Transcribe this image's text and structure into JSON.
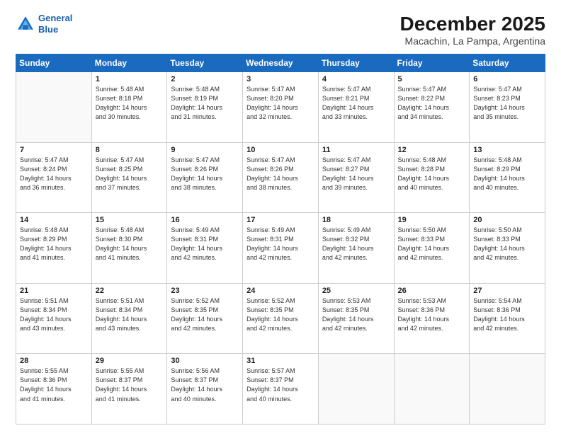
{
  "logo": {
    "line1": "General",
    "line2": "Blue"
  },
  "title": "December 2025",
  "subtitle": "Macachin, La Pampa, Argentina",
  "days_header": [
    "Sunday",
    "Monday",
    "Tuesday",
    "Wednesday",
    "Thursday",
    "Friday",
    "Saturday"
  ],
  "weeks": [
    [
      {
        "num": "",
        "info": ""
      },
      {
        "num": "1",
        "info": "Sunrise: 5:48 AM\nSunset: 8:18 PM\nDaylight: 14 hours\nand 30 minutes."
      },
      {
        "num": "2",
        "info": "Sunrise: 5:48 AM\nSunset: 8:19 PM\nDaylight: 14 hours\nand 31 minutes."
      },
      {
        "num": "3",
        "info": "Sunrise: 5:47 AM\nSunset: 8:20 PM\nDaylight: 14 hours\nand 32 minutes."
      },
      {
        "num": "4",
        "info": "Sunrise: 5:47 AM\nSunset: 8:21 PM\nDaylight: 14 hours\nand 33 minutes."
      },
      {
        "num": "5",
        "info": "Sunrise: 5:47 AM\nSunset: 8:22 PM\nDaylight: 14 hours\nand 34 minutes."
      },
      {
        "num": "6",
        "info": "Sunrise: 5:47 AM\nSunset: 8:23 PM\nDaylight: 14 hours\nand 35 minutes."
      }
    ],
    [
      {
        "num": "7",
        "info": "Sunrise: 5:47 AM\nSunset: 8:24 PM\nDaylight: 14 hours\nand 36 minutes."
      },
      {
        "num": "8",
        "info": "Sunrise: 5:47 AM\nSunset: 8:25 PM\nDaylight: 14 hours\nand 37 minutes."
      },
      {
        "num": "9",
        "info": "Sunrise: 5:47 AM\nSunset: 8:26 PM\nDaylight: 14 hours\nand 38 minutes."
      },
      {
        "num": "10",
        "info": "Sunrise: 5:47 AM\nSunset: 8:26 PM\nDaylight: 14 hours\nand 38 minutes."
      },
      {
        "num": "11",
        "info": "Sunrise: 5:47 AM\nSunset: 8:27 PM\nDaylight: 14 hours\nand 39 minutes."
      },
      {
        "num": "12",
        "info": "Sunrise: 5:48 AM\nSunset: 8:28 PM\nDaylight: 14 hours\nand 40 minutes."
      },
      {
        "num": "13",
        "info": "Sunrise: 5:48 AM\nSunset: 8:29 PM\nDaylight: 14 hours\nand 40 minutes."
      }
    ],
    [
      {
        "num": "14",
        "info": "Sunrise: 5:48 AM\nSunset: 8:29 PM\nDaylight: 14 hours\nand 41 minutes."
      },
      {
        "num": "15",
        "info": "Sunrise: 5:48 AM\nSunset: 8:30 PM\nDaylight: 14 hours\nand 41 minutes."
      },
      {
        "num": "16",
        "info": "Sunrise: 5:49 AM\nSunset: 8:31 PM\nDaylight: 14 hours\nand 42 minutes."
      },
      {
        "num": "17",
        "info": "Sunrise: 5:49 AM\nSunset: 8:31 PM\nDaylight: 14 hours\nand 42 minutes."
      },
      {
        "num": "18",
        "info": "Sunrise: 5:49 AM\nSunset: 8:32 PM\nDaylight: 14 hours\nand 42 minutes."
      },
      {
        "num": "19",
        "info": "Sunrise: 5:50 AM\nSunset: 8:33 PM\nDaylight: 14 hours\nand 42 minutes."
      },
      {
        "num": "20",
        "info": "Sunrise: 5:50 AM\nSunset: 8:33 PM\nDaylight: 14 hours\nand 42 minutes."
      }
    ],
    [
      {
        "num": "21",
        "info": "Sunrise: 5:51 AM\nSunset: 8:34 PM\nDaylight: 14 hours\nand 43 minutes."
      },
      {
        "num": "22",
        "info": "Sunrise: 5:51 AM\nSunset: 8:34 PM\nDaylight: 14 hours\nand 43 minutes."
      },
      {
        "num": "23",
        "info": "Sunrise: 5:52 AM\nSunset: 8:35 PM\nDaylight: 14 hours\nand 42 minutes."
      },
      {
        "num": "24",
        "info": "Sunrise: 5:52 AM\nSunset: 8:35 PM\nDaylight: 14 hours\nand 42 minutes."
      },
      {
        "num": "25",
        "info": "Sunrise: 5:53 AM\nSunset: 8:35 PM\nDaylight: 14 hours\nand 42 minutes."
      },
      {
        "num": "26",
        "info": "Sunrise: 5:53 AM\nSunset: 8:36 PM\nDaylight: 14 hours\nand 42 minutes."
      },
      {
        "num": "27",
        "info": "Sunrise: 5:54 AM\nSunset: 8:36 PM\nDaylight: 14 hours\nand 42 minutes."
      }
    ],
    [
      {
        "num": "28",
        "info": "Sunrise: 5:55 AM\nSunset: 8:36 PM\nDaylight: 14 hours\nand 41 minutes."
      },
      {
        "num": "29",
        "info": "Sunrise: 5:55 AM\nSunset: 8:37 PM\nDaylight: 14 hours\nand 41 minutes."
      },
      {
        "num": "30",
        "info": "Sunrise: 5:56 AM\nSunset: 8:37 PM\nDaylight: 14 hours\nand 40 minutes."
      },
      {
        "num": "31",
        "info": "Sunrise: 5:57 AM\nSunset: 8:37 PM\nDaylight: 14 hours\nand 40 minutes."
      },
      {
        "num": "",
        "info": ""
      },
      {
        "num": "",
        "info": ""
      },
      {
        "num": "",
        "info": ""
      }
    ]
  ]
}
